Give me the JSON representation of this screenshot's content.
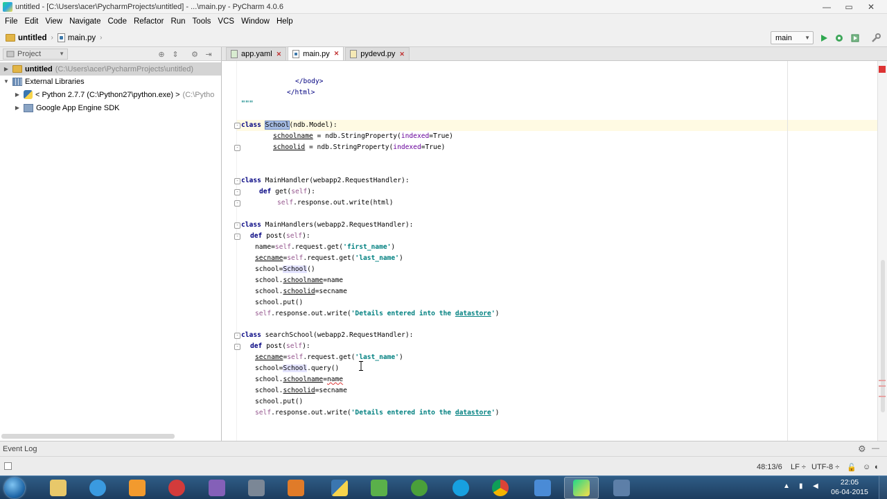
{
  "window": {
    "title": "untitled - [C:\\Users\\acer\\PycharmProjects\\untitled] - ...\\main.py - PyCharm 4.0.6",
    "minimize": "—",
    "maximize": "▭",
    "close": "✕"
  },
  "menu": [
    "File",
    "Edit",
    "View",
    "Navigate",
    "Code",
    "Refactor",
    "Run",
    "Tools",
    "VCS",
    "Window",
    "Help"
  ],
  "navbar": {
    "project": "untitled",
    "file": "main.py",
    "run_config": "main"
  },
  "project_panel": {
    "tab_label": "Project",
    "tree": [
      {
        "label": "untitled",
        "path": "(C:\\Users\\acer\\PycharmProjects\\untitled)"
      },
      {
        "label": "External Libraries"
      },
      {
        "label": "< Python 2.7.7 (C:\\Python27\\python.exe) >",
        "path": "(C:\\Pytho"
      },
      {
        "label": "Google App Engine SDK"
      }
    ]
  },
  "tabs": [
    {
      "label": "app.yaml"
    },
    {
      "label": "main.py"
    },
    {
      "label": "pydevd.py"
    }
  ],
  "code": {
    "l0": "</body>",
    "l1": "</html>",
    "l2": "\"\"\"",
    "l3_kw": "class",
    "l3_name": "School",
    "l3_rest": "(ndb.Model):",
    "l4_attr": "schoolname",
    "l4_mid": " = ndb.StringProperty(",
    "l4_param": "indexed",
    "l4_end": "=True)",
    "l5_attr": "schoolid",
    "l5_mid": " = ndb.StringProperty(",
    "l5_param": "indexed",
    "l5_end": "=True)",
    "l6_kw": "class",
    "l6_rest": " MainHandler(webapp2.RequestHandler):",
    "l7_kw": "def",
    "l7_name": " get(",
    "l7_self": "self",
    "l7_end": "):",
    "l8_self": "self",
    "l8_rest": ".response.out.write(html)",
    "l9_kw": "class",
    "l9_rest": " MainHandlers(webapp2.RequestHandler):",
    "l10_kw": "def",
    "l10_name": " post(",
    "l10_self": "self",
    "l10_end": "):",
    "l11_a": "name=",
    "l11_self": "self",
    "l11_b": ".request.get(",
    "l11_str": "'first_name'",
    "l11_end": ")",
    "l12_a": "secname",
    "l12_eq": "=",
    "l12_self": "self",
    "l12_b": ".request.get(",
    "l12_str": "'last_name'",
    "l12_end": ")",
    "l13_a": "school=",
    "l13_cls": "School",
    "l13_end": "()",
    "l14_a": "school.",
    "l14_attr": "schoolname",
    "l14_end": "=name",
    "l15_a": "school.",
    "l15_attr": "schoolid",
    "l15_end": "=secname",
    "l16": "school.put()",
    "l17_self": "self",
    "l17_b": ".response.out.write(",
    "l17_str": "'Details entered into the ",
    "l17_ul": "datastore",
    "l17_q": "'",
    "l17_end": ")",
    "l18_kw": "class",
    "l18_rest": " searchSchool(webapp2.RequestHandler):",
    "l19_kw": "def",
    "l19_name": " post(",
    "l19_self": "self",
    "l19_end": "):",
    "l20_a": "secname",
    "l20_eq": "=",
    "l20_self": "self",
    "l20_b": ".request.get(",
    "l20_str": "'last_name'",
    "l20_end": ")",
    "l21_a": "school=",
    "l21_cls": "School",
    "l21_end": ".query()",
    "l22_a": "school.",
    "l22_attr": "schoolname",
    "l22_eq": "=",
    "l22_err": "name",
    "l23_a": "school.",
    "l23_attr": "schoolid",
    "l23_end": "=secname",
    "l24": "school.put()",
    "l25_self": "self",
    "l25_b": ".response.out.write(",
    "l25_str": "'Details entered into the ",
    "l25_ul": "datastore",
    "l25_q": "'",
    "l25_end": ")"
  },
  "event_log": "Event Log",
  "status": {
    "position": "48:13/6",
    "line_sep": "LF ÷",
    "encoding": "UTF-8 ÷"
  },
  "taskbar": {
    "clock_time": "22:05",
    "clock_date": "06-04-2015",
    "tray_arrow": "▲"
  },
  "colors": {
    "keyword": "#000080",
    "string": "#008080",
    "self": "#94558d",
    "selection": "#a6bce3",
    "caret_row": "#fffae3"
  }
}
